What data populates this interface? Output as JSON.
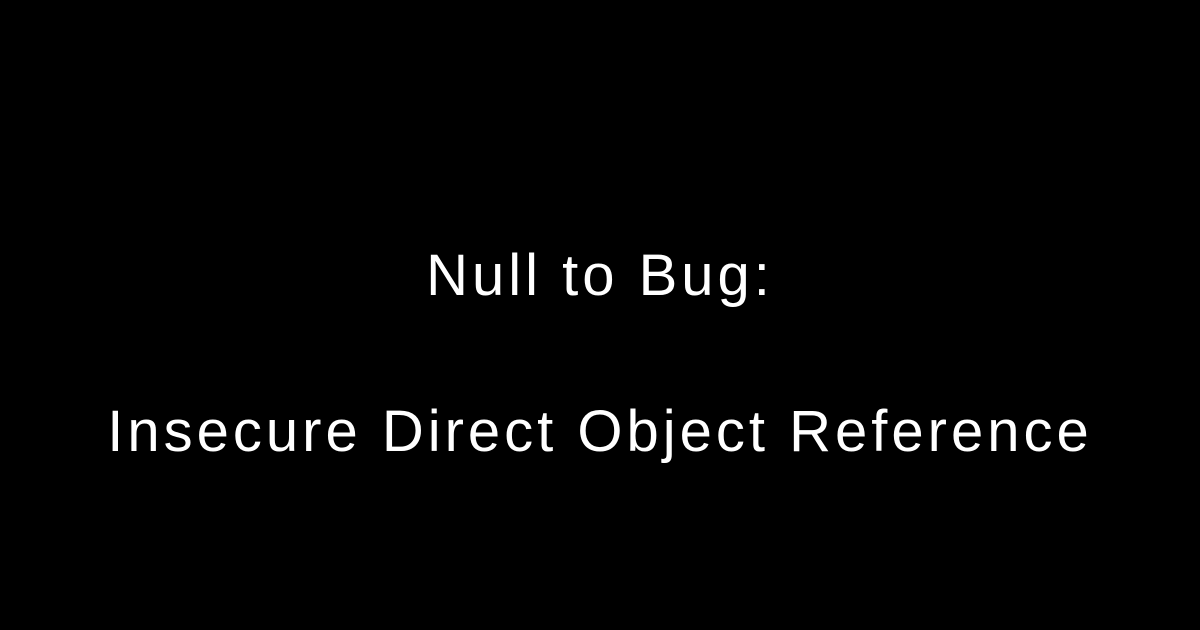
{
  "title": {
    "line1": "Null to Bug:",
    "line2": "Insecure Direct Object Reference"
  },
  "colors": {
    "background": "#000000",
    "text": "#ffffff"
  }
}
